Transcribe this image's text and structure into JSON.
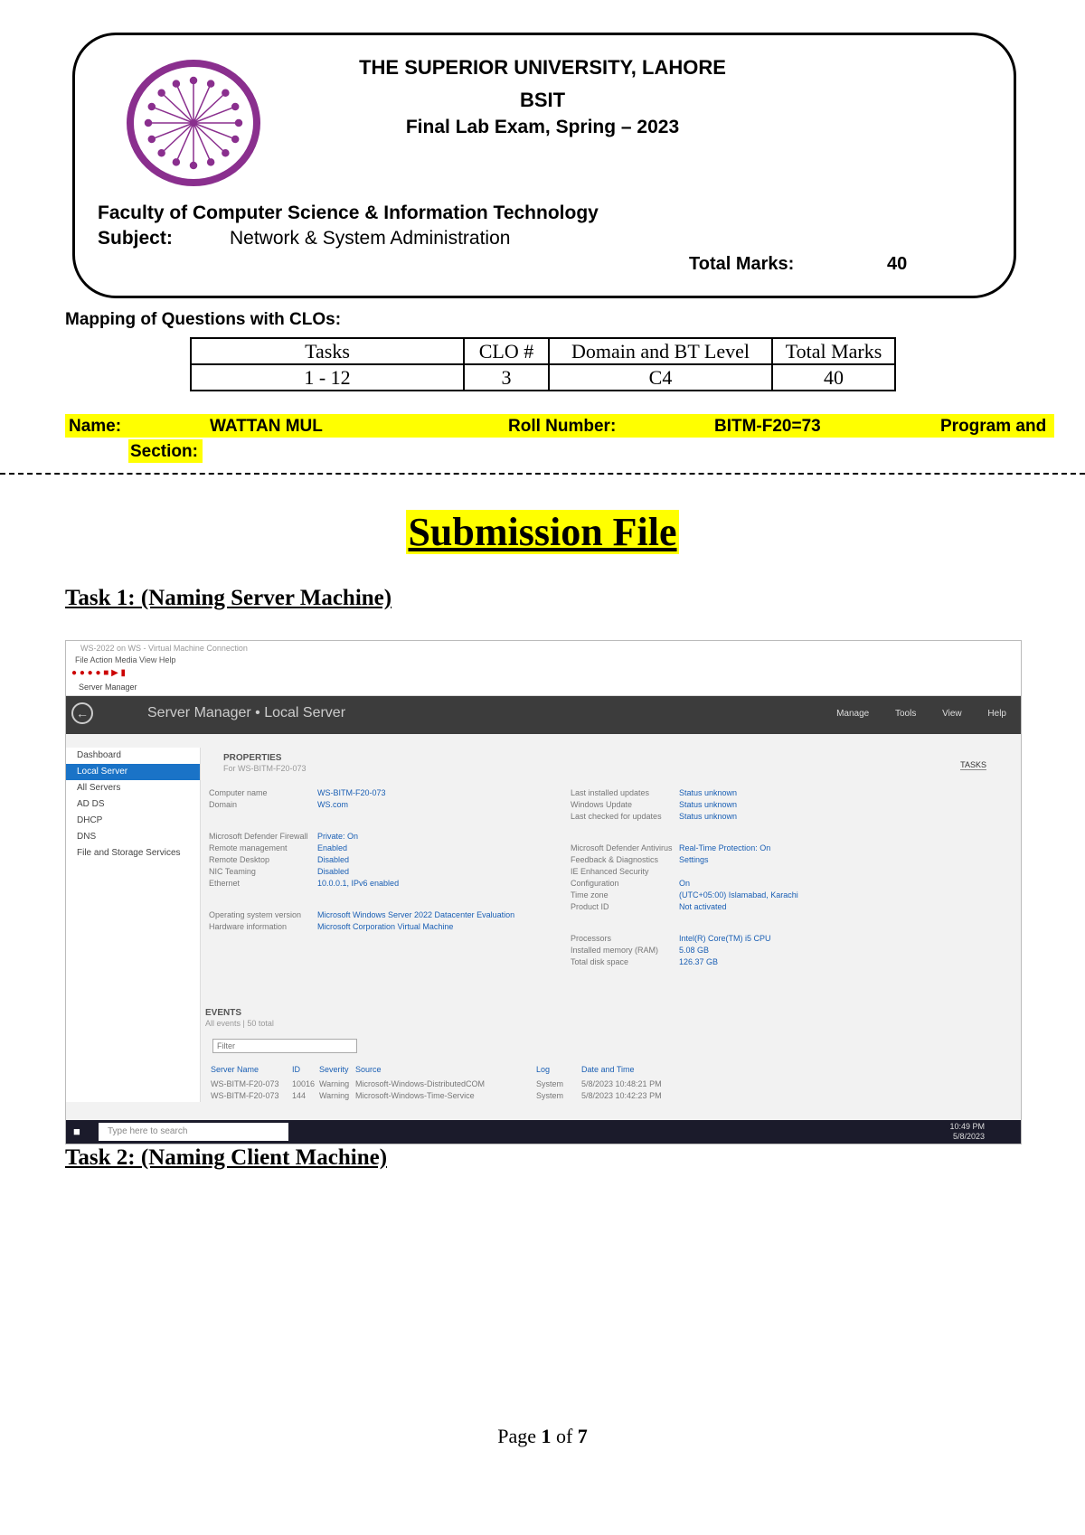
{
  "header": {
    "university": "THE SUPERIOR UNIVERSITY, LAHORE",
    "program": "BSIT",
    "exam": "Final Lab Exam, Spring – 2023",
    "faculty": "Faculty of Computer Science & Information Technology",
    "subject_label": "Subject:",
    "subject_value": "Network & System Administration",
    "total_marks_label": "Total Marks:",
    "total_marks_value": "40"
  },
  "mapping": {
    "heading": "Mapping of Questions with CLOs:",
    "columns": [
      "Tasks",
      "CLO #",
      "Domain and BT Level",
      "Total Marks"
    ],
    "row": [
      "1 - 12",
      "3",
      "C4",
      "40"
    ]
  },
  "student": {
    "name_label": "Name:",
    "name_value": "WATTAN MUL",
    "roll_label": "Roll Number:",
    "roll_value": "BITM-F20=73",
    "program_label": "Program and",
    "section_label": "Section:"
  },
  "title": "Submission File",
  "tasks": {
    "task1": "Task 1: (Naming Server Machine)",
    "task2": "Task 2: (Naming Client Machine)"
  },
  "screenshot": {
    "window_title": "WS-2022 on WS - Virtual Machine Connection",
    "menu": "File   Action   Media   View   Help",
    "app_label": "Server Manager",
    "breadcrumb": "Server Manager • Local Server",
    "top_menus": [
      "Manage",
      "Tools",
      "View",
      "Help"
    ],
    "sidebar": [
      "Dashboard",
      "Local Server",
      "All Servers",
      "AD DS",
      "DHCP",
      "DNS",
      "File and Storage Services"
    ],
    "properties_heading": "PROPERTIES",
    "properties_sub": "For WS-BITM-F20-073",
    "tasks_btn": "TASKS",
    "props_left": [
      [
        "Computer name",
        "WS-BITM-F20-073"
      ],
      [
        "Domain",
        "WS.com"
      ],
      [
        "Microsoft Defender Firewall",
        "Private: On"
      ],
      [
        "Remote management",
        "Enabled"
      ],
      [
        "Remote Desktop",
        "Disabled"
      ],
      [
        "NIC Teaming",
        "Disabled"
      ],
      [
        "Ethernet",
        "10.0.0.1, IPv6 enabled"
      ],
      [
        "Operating system version",
        "Microsoft Windows Server 2022 Datacenter Evaluation"
      ],
      [
        "Hardware information",
        "Microsoft Corporation Virtual Machine"
      ]
    ],
    "props_right": [
      [
        "Last installed updates",
        "Status unknown"
      ],
      [
        "Windows Update",
        "Status unknown"
      ],
      [
        "Last checked for updates",
        "Status unknown"
      ],
      [
        "Microsoft Defender Antivirus",
        "Real-Time Protection: On"
      ],
      [
        "Feedback & Diagnostics",
        "Settings"
      ],
      [
        "IE Enhanced Security Configuration",
        "On"
      ],
      [
        "Time zone",
        "(UTC+05:00) Islamabad, Karachi"
      ],
      [
        "Product ID",
        "Not activated"
      ],
      [
        "Processors",
        "Intel(R) Core(TM) i5 CPU"
      ],
      [
        "Installed memory (RAM)",
        "5.08 GB"
      ],
      [
        "Total disk space",
        "126.37 GB"
      ]
    ],
    "events_heading": "EVENTS",
    "events_sub": "All events | 50 total",
    "filter_placeholder": "Filter",
    "event_columns": [
      "Server Name",
      "ID",
      "Severity",
      "Source",
      "Log",
      "Date and Time"
    ],
    "event_rows": [
      [
        "WS-BITM-F20-073",
        "10016",
        "Warning",
        "Microsoft-Windows-DistributedCOM",
        "System",
        "5/8/2023 10:48:21 PM"
      ],
      [
        "WS-BITM-F20-073",
        "144",
        "Warning",
        "Microsoft-Windows-Time-Service",
        "System",
        "5/8/2023 10:42:23 PM"
      ]
    ],
    "taskbar_search": "Type here to search",
    "clock_time": "10:49 PM",
    "clock_date": "5/8/2023"
  },
  "footer": {
    "page_label": "Page",
    "page_num": "1",
    "of_label": "of",
    "page_total": "7"
  }
}
